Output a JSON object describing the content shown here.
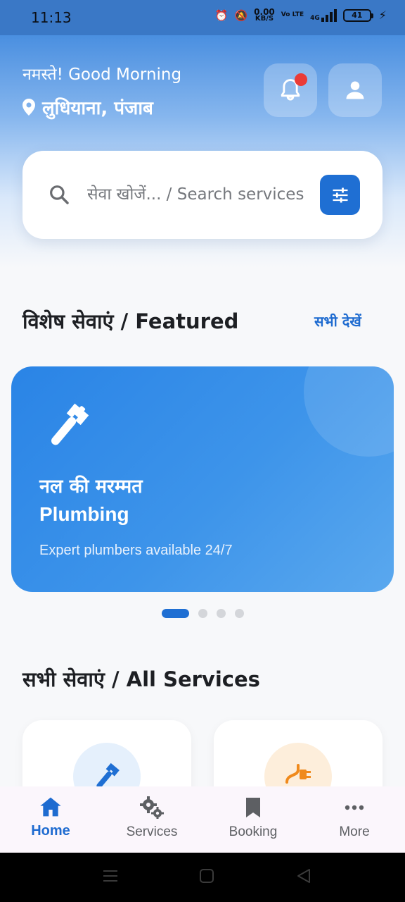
{
  "status_bar": {
    "time": "11:13",
    "net_speed_value": "0.00",
    "net_speed_unit": "KB/S",
    "network_type": "4G",
    "volte": "Vo LTE",
    "battery_level": "41"
  },
  "header": {
    "greeting": "नमस्ते! Good Morning",
    "location": "लुधियाना, पंजाब",
    "has_notification": true
  },
  "search": {
    "placeholder": "सेवा खोजें... / Search services"
  },
  "featured": {
    "title": "विशेष सेवाएं / Featured",
    "see_all_label": "सभी देखें",
    "card": {
      "icon": "wrench-icon",
      "title_hindi": "नल की मरम्मत",
      "title_english": "Plumbing",
      "description": "Expert plumbers available 24/7"
    },
    "carousel_pages": 4,
    "carousel_active_index": 0
  },
  "all_services": {
    "title": "सभी सेवाएं / All Services",
    "cards": [
      {
        "icon": "wrench-icon"
      },
      {
        "icon": "plug-icon"
      }
    ]
  },
  "bottom_nav": {
    "items": [
      {
        "label": "Home",
        "icon": "home-icon",
        "active": true
      },
      {
        "label": "Services",
        "icon": "gears-icon",
        "active": false
      },
      {
        "label": "Booking",
        "icon": "bookmark-icon",
        "active": false
      },
      {
        "label": "More",
        "icon": "more-dots-icon",
        "active": false
      }
    ]
  },
  "colors": {
    "primary": "#1f6fd3",
    "notification_dot": "#ea3b37",
    "plug_accent": "#f08a1c"
  }
}
